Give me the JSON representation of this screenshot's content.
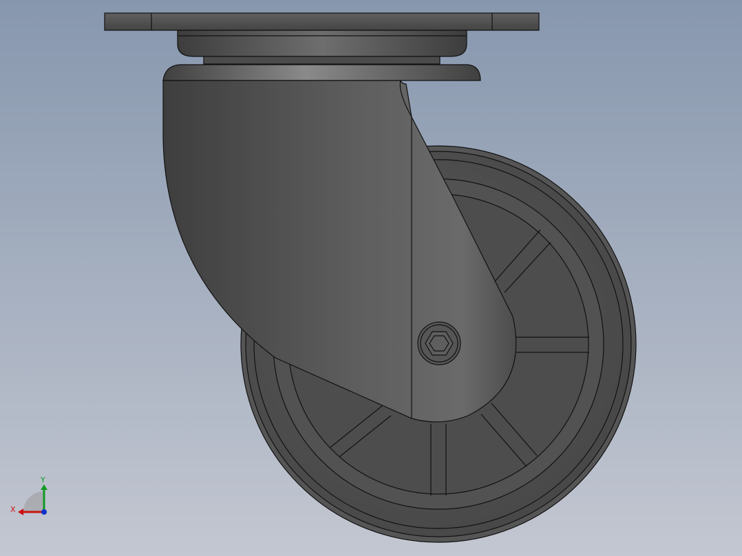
{
  "viewport": {
    "background_top": "#8797AE",
    "background_bottom": "#C3C7D1",
    "model_base_color": "#4F4F4F",
    "edge_color": "#111111"
  },
  "triad": {
    "x_label": "X",
    "y_label": "Y",
    "x_color": "#CC1111",
    "y_color": "#119922",
    "z_color": "#1133CC"
  }
}
